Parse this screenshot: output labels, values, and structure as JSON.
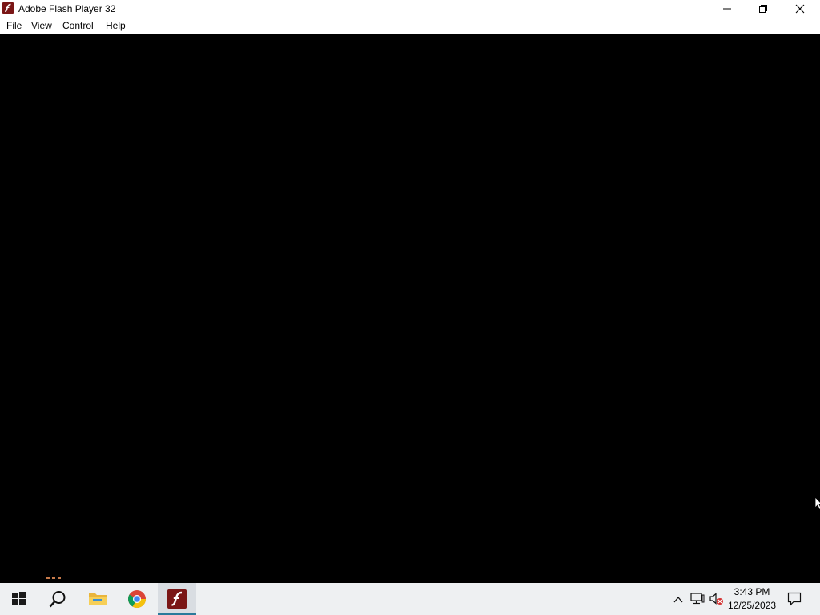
{
  "window": {
    "title": "Adobe Flash Player 32",
    "app_icon": "flash-player-icon",
    "controls": {
      "minimize_icon": "minimize-icon",
      "maximize_icon": "restore-icon",
      "close_icon": "close-icon"
    }
  },
  "menubar": {
    "items": [
      {
        "label": "File"
      },
      {
        "label": "View"
      },
      {
        "label": "Control"
      },
      {
        "label": "Help"
      }
    ]
  },
  "stage": {
    "background": "#000000"
  },
  "taskbar": {
    "start_icon": "windows-start-icon",
    "search_icon": "search-icon",
    "pinned": [
      {
        "icon": "file-explorer-icon"
      },
      {
        "icon": "chrome-icon"
      },
      {
        "icon": "flash-player-icon",
        "active": true
      }
    ],
    "tray": {
      "overflow_icon": "chevron-up-icon",
      "network_icon": "network-icon",
      "volume_icon": "volume-muted-icon",
      "time": "3:43 PM",
      "date": "12/25/2023",
      "notifications_icon": "notification-icon"
    },
    "accent_color": "#2b7a9b"
  }
}
